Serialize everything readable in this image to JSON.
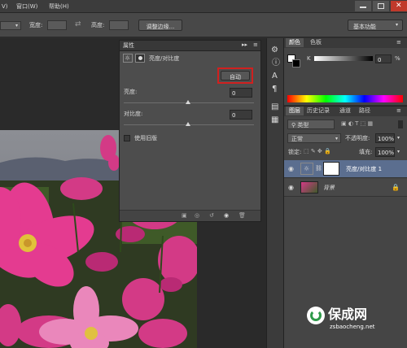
{
  "menu": {
    "items": [
      "V)",
      "窗口(W)",
      "帮助(H)"
    ]
  },
  "options_bar": {
    "width_label": "宽度:",
    "height_label": "高度:",
    "refine_edge_button": "调整边缘...",
    "workspace_select": "基本功能"
  },
  "properties_panel": {
    "tab": "属性",
    "title": "亮度/对比度",
    "auto_button": "自动",
    "brightness_label": "亮度:",
    "brightness_value": "0",
    "contrast_label": "对比度:",
    "contrast_value": "0",
    "legacy_checkbox_label": "使用旧版"
  },
  "color_panel": {
    "tabs": [
      "颜色",
      "色板"
    ],
    "channel_label": "K",
    "value": "0",
    "unit": "%"
  },
  "layers_panel": {
    "tabs": [
      "图层",
      "历史记录",
      "通道",
      "路径"
    ],
    "filter_select": "类型",
    "blend_mode": "正常",
    "opacity_label": "不透明度:",
    "opacity_value": "100%",
    "lock_label": "锁定:",
    "fill_label": "填充:",
    "fill_value": "100%",
    "layers": [
      {
        "name": "亮度/对比度 1"
      },
      {
        "name": "背景"
      }
    ]
  },
  "watermark": {
    "text": "保成网",
    "url": "zsbaocheng.net"
  },
  "colors": {
    "highlight_border": "#d0201f",
    "selected_layer": "#5b6e8f",
    "photo_pink": "#e0368a"
  }
}
